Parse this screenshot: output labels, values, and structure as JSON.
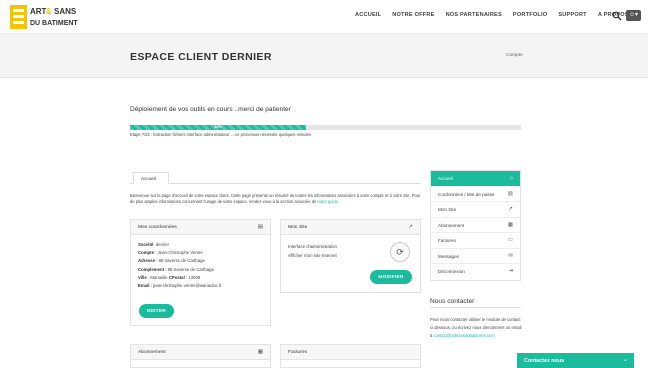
{
  "brand": {
    "logo_line1": "ART",
    "logo_and": "&",
    "logo_line1b": "SANS",
    "logo_line2": "DU BATIMENT",
    "accent": "#1abc9c",
    "logo_yellow": "#f5c400"
  },
  "nav": {
    "items": [
      "ACCUEIL",
      "NOTRE OFFRE",
      "NOS PARTENAIRES",
      "PORTFOLIO",
      "SUPPORT",
      "A PROPOS"
    ],
    "search_icon": "search-icon",
    "user_icon": "user-icon"
  },
  "page": {
    "title": "ESPACE CLIENT DERNIER",
    "breadcrumb": "Compte"
  },
  "deploy": {
    "title": "Déploiement de vos outils en cours ..merci de patienter",
    "progress_percent": 45,
    "progress_label": "45%",
    "step_text": "Etape 7/22 : Extraction fichiers interface administrateur ... ce processus nécessite quelques minutes"
  },
  "tab": {
    "label": "Accueil"
  },
  "intro": {
    "text": "Bienvenue sur la page d'accueil de votre espace client. Cette page présente un résumé de toutes les informations associées à votre compte et à votre site. Pour de plus amples informations concernant l'usage de votre espace, rendez-vous à la section associée de ",
    "link": "notre guide",
    "end": "."
  },
  "coords": {
    "title": "Mes coordonnées",
    "icon": "id-card-icon",
    "rows": [
      {
        "label": "Société",
        "value": "dernier"
      },
      {
        "label": "Compte",
        "value": "Jean-Christophe Ventre"
      },
      {
        "label": "Adresse",
        "value": "85 traverse de Carthage"
      },
      {
        "label": "Complement",
        "value": "85 traverse de Carthage"
      },
      {
        "label": "Ville",
        "value": "Marseille",
        "label2": "CPostal",
        "value2": "13008"
      },
      {
        "label": "Email",
        "value": "jean-christophe.ventre@wanadoo.fr"
      }
    ],
    "button": "EDITER"
  },
  "site": {
    "title": "Mon Site",
    "icon": "rocket-icon",
    "line1": "Interface d'administration",
    "line2": "Afficher mon site Internet",
    "refresh_icon": "refresh-icon",
    "button": "MODIFIER"
  },
  "abonnement": {
    "title": "Abonnement",
    "icon": "calendar-icon"
  },
  "factures": {
    "title": "Factures"
  },
  "menu": [
    {
      "label": "Accueil",
      "icon": "home-icon",
      "glyph": "⌂",
      "active": true
    },
    {
      "label": "Cordonnées / Mot de passe",
      "icon": "id-card-icon",
      "glyph": "▤",
      "active": false
    },
    {
      "label": "Mon Site",
      "icon": "rocket-icon",
      "glyph": "➚",
      "active": false
    },
    {
      "label": "Abonnement",
      "icon": "calendar-icon",
      "glyph": "▦",
      "active": false
    },
    {
      "label": "Factures",
      "icon": "money-icon",
      "glyph": "▭",
      "active": false
    },
    {
      "label": "Messages",
      "icon": "messages-icon",
      "glyph": "✉",
      "active": false
    },
    {
      "label": "Déconnexion",
      "icon": "logout-icon",
      "glyph": "⇥",
      "active": false
    }
  ],
  "contact": {
    "title": "Nous contacter",
    "text": "Pour nous contacter utiliser le module de contact ci dessous, ou écrivez nous directement un email à",
    "email": "contact@artsansdubatiment.com",
    "bar_label": "Contactez nous",
    "bar_icon": "chevron-down-icon"
  }
}
